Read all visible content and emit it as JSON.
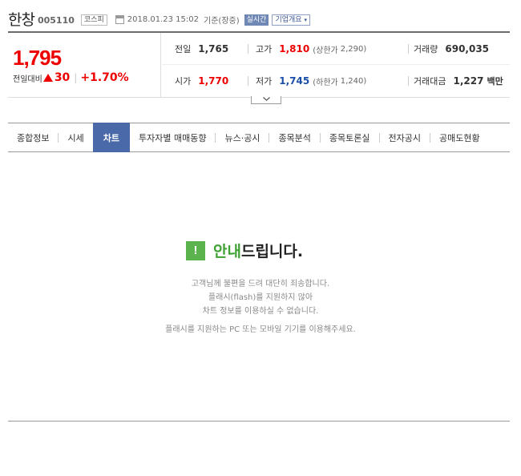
{
  "header": {
    "stock_name": "한창",
    "stock_code": "005110",
    "market_badge": "코스피",
    "datetime": "2018.01.23 15:02",
    "basis": "기준(장중)",
    "realtime_badge": "실시간",
    "company_overview": "기업개요",
    "company_caret": "▾"
  },
  "price": {
    "current": "1,795",
    "prev_compare_label": "전일대비",
    "change_amount": "30",
    "separator": "|",
    "change_percent": "+1.70%",
    "cells": {
      "prev_close_label": "전일",
      "prev_close": "1,765",
      "high_label": "고가",
      "high": "1,810",
      "upper_limit_label": "(상한가",
      "upper_limit": "2,290)",
      "volume_label": "거래량",
      "volume": "690,035",
      "open_label": "시가",
      "open": "1,770",
      "low_label": "저가",
      "low": "1,745",
      "lower_limit_label": "(하한가",
      "lower_limit": "1,240)",
      "trade_value_label": "거래대금",
      "trade_value": "1,227",
      "trade_value_unit": "백만"
    },
    "up_color": "#e00000",
    "down_color": "#1a4ea8"
  },
  "tabs": [
    {
      "label": "종합정보",
      "active": false
    },
    {
      "label": "시세",
      "active": false
    },
    {
      "label": "차트",
      "active": true
    },
    {
      "label": "투자자별 매매동향",
      "active": false
    },
    {
      "label": "뉴스·공시",
      "active": false
    },
    {
      "label": "종목분석",
      "active": false
    },
    {
      "label": "종목토론실",
      "active": false
    },
    {
      "label": "전자공시",
      "active": false
    },
    {
      "label": "공매도현황",
      "active": false
    }
  ],
  "notice": {
    "icon": "!",
    "title_green": "안내",
    "title_dark": "드립니다.",
    "lines": [
      "고객님께 불편을 드려 대단히 죄송합니다.",
      "플래시(flash)를 지원하지 않아",
      "차트 정보를 이용하실 수 없습니다."
    ],
    "footer": "플래시를 지원하는 PC 또는 모바일 기기를 이용해주세요."
  },
  "colors": {
    "accent_tab": "#4a69a8",
    "notice_green": "#3ea132"
  }
}
